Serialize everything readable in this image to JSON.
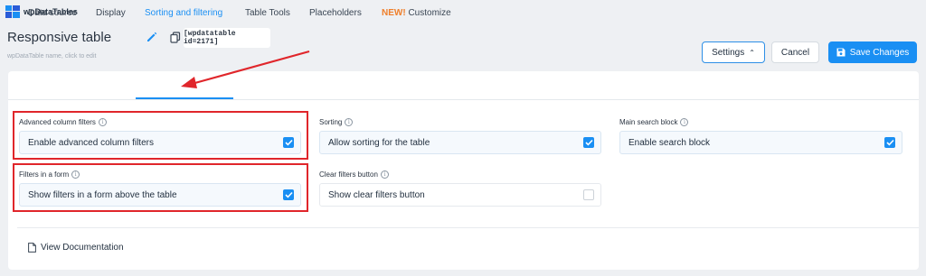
{
  "app": {
    "brand": "wpDataTables"
  },
  "header": {
    "title": "Responsive table",
    "subtitle": "wpDataTable name, click to edit",
    "shortcode": "[wpdatatable id=2171]"
  },
  "toolbar": {
    "settings_label": "Settings",
    "cancel_label": "Cancel",
    "save_label": "Save Changes"
  },
  "tabs": [
    {
      "label": "Data source"
    },
    {
      "label": "Display"
    },
    {
      "label": "Sorting and filtering",
      "active": true
    },
    {
      "label": "Table Tools"
    },
    {
      "label": "Placeholders"
    },
    {
      "badge": "NEW!",
      "label": "Customize"
    }
  ],
  "options": {
    "advanced_filters": {
      "label": "Advanced column filters",
      "value": "Enable advanced column filters",
      "checked": true
    },
    "sorting": {
      "label": "Sorting",
      "value": "Allow sorting for the table",
      "checked": true
    },
    "search": {
      "label": "Main search block",
      "value": "Enable search block",
      "checked": true
    },
    "filters_form": {
      "label": "Filters in a form",
      "value": "Show filters in a form above the table",
      "checked": true
    },
    "clear_filters": {
      "label": "Clear filters button",
      "value": "Show clear filters button",
      "checked": false
    }
  },
  "footer": {
    "doc_link": "View Documentation"
  },
  "colors": {
    "accent": "#1a8ff3",
    "highlight": "#e0262b",
    "new_badge": "#ef7f2b"
  },
  "icons": [
    "table-logo-icon",
    "pencil-icon",
    "copy-icon",
    "chevron-up-icon",
    "save-icon",
    "info-icon",
    "checkbox-icon",
    "document-icon",
    "annotation-arrow"
  ]
}
